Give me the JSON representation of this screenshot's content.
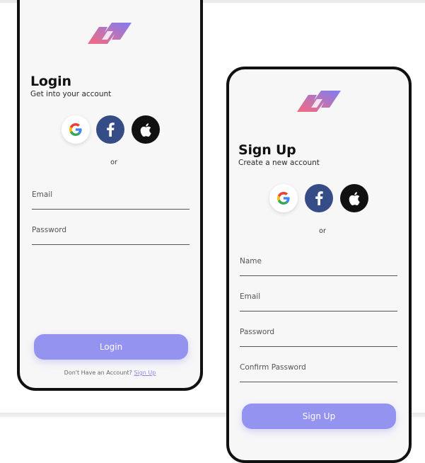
{
  "login": {
    "title": "Login",
    "subtitle": "Get into your account",
    "or_label": "or",
    "email_label": "Email",
    "password_label": "Password",
    "button_label": "Login",
    "footer_prompt": "Don't Have an Account?",
    "footer_link": "Sign Up"
  },
  "signup": {
    "title": "Sign Up",
    "subtitle": "Create a new account",
    "or_label": "or",
    "name_label": "Name",
    "email_label": "Email",
    "password_label": "Password",
    "confirm_password_label": "Confirm Password",
    "button_label": "Sign Up"
  },
  "icons": {
    "logo": "app-logo",
    "google": "google-icon",
    "facebook": "facebook-icon",
    "apple": "apple-icon"
  },
  "colors": {
    "primary": "#9593f0",
    "facebook": "#364c86",
    "apple": "#111111",
    "logo_gradient_start": "#f66a7d",
    "logo_gradient_end": "#7f7df3"
  }
}
